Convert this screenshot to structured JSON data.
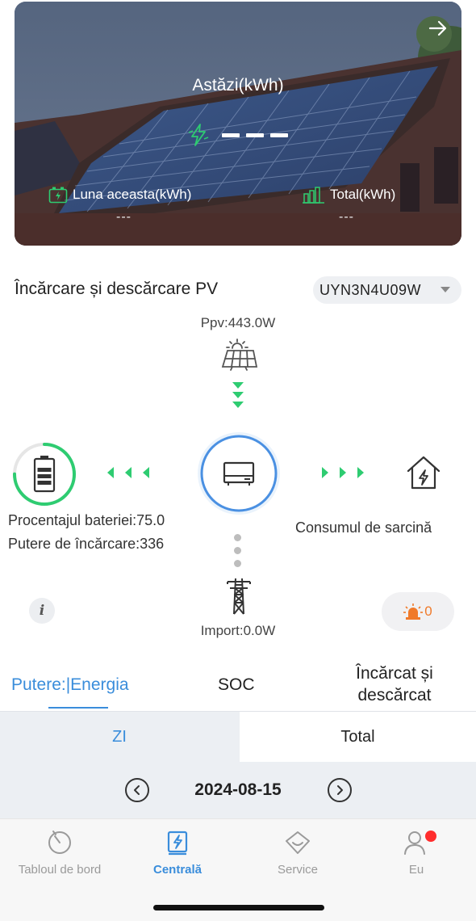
{
  "hero": {
    "today_label": "Astăzi(kWh)",
    "month_label": "Luna aceasta(kWh)",
    "month_value": "---",
    "total_label": "Total(kWh)",
    "total_value": "---"
  },
  "pv": {
    "title": "Încărcare și descărcare PV",
    "device": "UYN3N4U09W",
    "ppv": "Ppv:443.0W",
    "battery_percent": "Procentajul bateriei:75.0",
    "battery_level": 0.75,
    "charging_power": "Putere de încărcare:336",
    "load": "Consumul de sarcină",
    "import": "Import:0.0W",
    "info": "i",
    "alarm_count": "0"
  },
  "tabs": {
    "power_energy": "Putere:|Energia",
    "soc": "SOC",
    "charged_line1": "Încărcat și",
    "charged_line2": "descărcat"
  },
  "period": {
    "day": "ZI",
    "total": "Total"
  },
  "date": "2024-08-15",
  "nav": {
    "dashboard": "Tabloul de bord",
    "plant": "Centrală",
    "service": "Service",
    "me": "Eu"
  },
  "colors": {
    "accent": "#3a8ddb",
    "flow": "#2ecc71",
    "alarm": "#f07a2a",
    "badge": "#ff2d2d"
  }
}
